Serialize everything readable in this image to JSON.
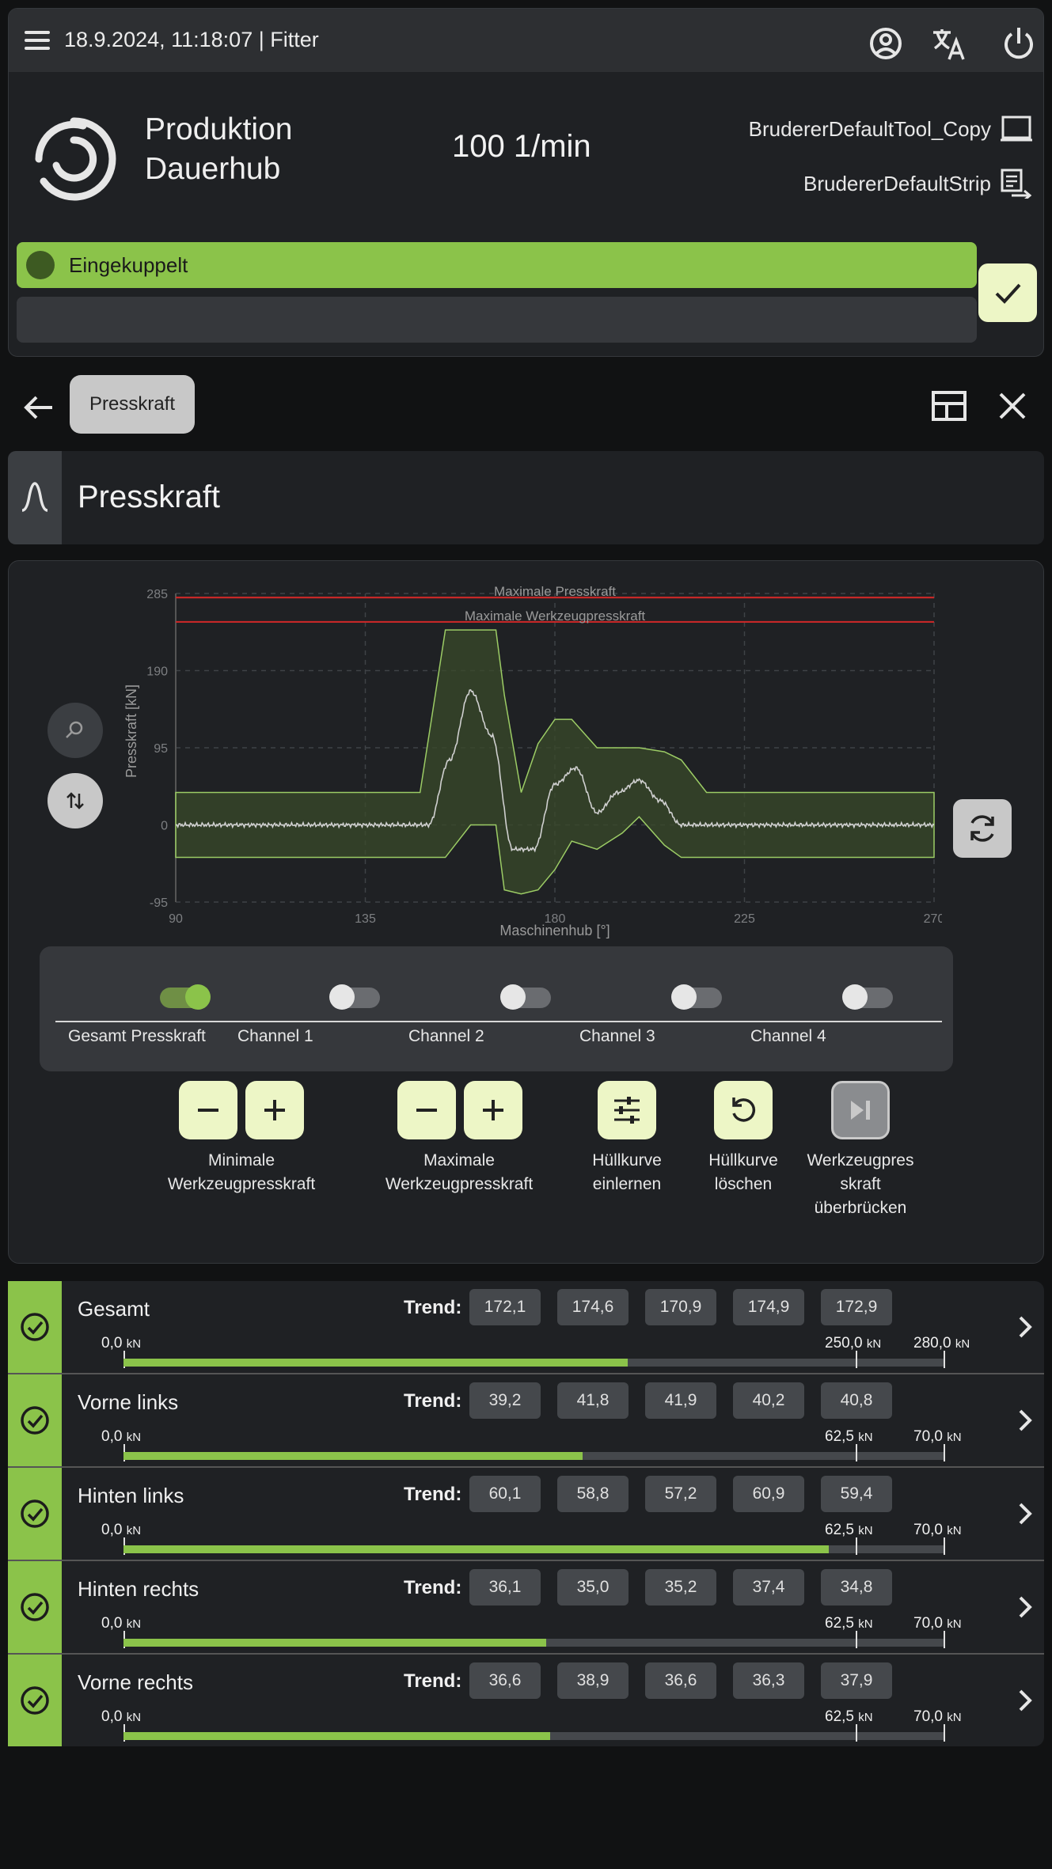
{
  "header": {
    "datetime": "18.9.2024, 11:18:07",
    "separator": "|",
    "user": "Fitter",
    "mode_line1": "Produktion",
    "mode_line2": "Dauerhub",
    "speed": "100 1/min",
    "tool_name": "BrudererDefaultTool_Copy",
    "strip_name": "BrudererDefaultStrip",
    "status_text": "Eingekuppelt",
    "status_color": "#8bc34a"
  },
  "nav": {
    "breadcrumb": "Presskraft"
  },
  "section": {
    "title": "Presskraft"
  },
  "chart": {
    "lbl_max_press": "Maximale Presskraft",
    "lbl_max_tool": "Maximale Werkzeugpresskraft",
    "xlabel": "Maschinenhub [°]",
    "ylabel": "Presskraft [kN]",
    "yticks": [
      "285",
      "190",
      "95",
      "0",
      "-95"
    ],
    "xticks": [
      "90",
      "135",
      "180",
      "225",
      "270"
    ]
  },
  "chart_data": {
    "type": "line",
    "xlabel": "Maschinenhub [°]",
    "ylabel": "Presskraft [kN]",
    "xlim": [
      90,
      270
    ],
    "ylim": [
      -95,
      285
    ],
    "grid": true,
    "hlines": [
      {
        "name": "Maximale Presskraft",
        "y": 280,
        "color": "#c62828"
      },
      {
        "name": "Maximale Werkzeugpresskraft",
        "y": 250,
        "color": "#c62828"
      }
    ],
    "series": [
      {
        "values_x": [
          90,
          150,
          155,
          160,
          165,
          170,
          175,
          180,
          185,
          190,
          195,
          200,
          205,
          210,
          215,
          270
        ],
        "values_y": [
          0,
          0,
          80,
          165,
          110,
          -30,
          -30,
          50,
          70,
          15,
          40,
          55,
          30,
          0,
          0,
          0
        ],
        "color": "#d0d0d0"
      }
    ],
    "envelope": {
      "x": [
        90,
        148,
        154,
        160,
        166,
        168,
        172,
        176,
        180,
        184,
        190,
        196,
        200,
        206,
        210,
        216,
        270
      ],
      "upper": [
        40,
        40,
        240,
        240,
        240,
        160,
        40,
        100,
        130,
        130,
        95,
        95,
        95,
        90,
        80,
        40,
        40
      ],
      "lower": [
        -40,
        -40,
        -40,
        0,
        0,
        -80,
        -85,
        -80,
        -55,
        -20,
        -30,
        -10,
        10,
        -25,
        -40,
        -40,
        -40
      ],
      "color": "#3a4a2a"
    }
  },
  "channels": [
    {
      "label": "Gesamt Presskraft",
      "on": true
    },
    {
      "label": "Channel 1",
      "on": false
    },
    {
      "label": "Channel 2",
      "on": false
    },
    {
      "label": "Channel 3",
      "on": false
    },
    {
      "label": "Channel 4",
      "on": false
    }
  ],
  "actions": {
    "min_label_1": "Minimale",
    "min_label_2": "Werkzeugpresskraft",
    "max_label_1": "Maximale",
    "max_label_2": "Werkzeugpresskraft",
    "learn_1": "Hüllkurve",
    "learn_2": "einlernen",
    "delete_1": "Hüllkurve",
    "delete_2": "löschen",
    "bypass_1": "Werkzeugpres",
    "bypass_2": "skraft",
    "bypass_3": "überbrücken"
  },
  "trend_label": "Trend:",
  "unit": "kN",
  "metrics": [
    {
      "name": "Gesamt",
      "trend": [
        "172,1",
        "174,6",
        "170,9",
        "174,9",
        "172,9"
      ],
      "min": "0,0",
      "warn": "250,0",
      "max": "280,0",
      "fill": 0.615
    },
    {
      "name": "Vorne links",
      "trend": [
        "39,2",
        "41,8",
        "41,9",
        "40,2",
        "40,8"
      ],
      "min": "0,0",
      "warn": "62,5",
      "max": "70,0",
      "fill": 0.56
    },
    {
      "name": "Hinten links",
      "trend": [
        "60,1",
        "58,8",
        "57,2",
        "60,9",
        "59,4"
      ],
      "min": "0,0",
      "warn": "62,5",
      "max": "70,0",
      "fill": 0.86
    },
    {
      "name": "Hinten rechts",
      "trend": [
        "36,1",
        "35,0",
        "35,2",
        "37,4",
        "34,8"
      ],
      "min": "0,0",
      "warn": "62,5",
      "max": "70,0",
      "fill": 0.515
    },
    {
      "name": "Vorne rechts",
      "trend": [
        "36,6",
        "38,9",
        "36,6",
        "36,3",
        "37,9"
      ],
      "min": "0,0",
      "warn": "62,5",
      "max": "70,0",
      "fill": 0.52
    }
  ]
}
